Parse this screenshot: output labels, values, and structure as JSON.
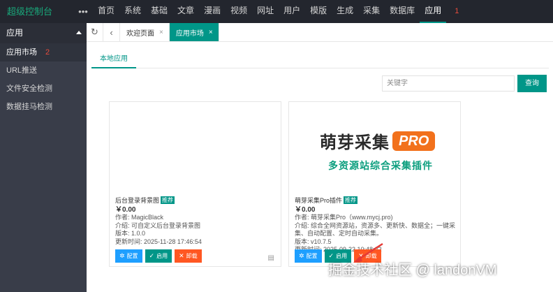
{
  "header": {
    "brand": "超级控制台",
    "dots": "•••",
    "nav": [
      "首页",
      "系统",
      "基础",
      "文章",
      "漫画",
      "视频",
      "网址",
      "用户",
      "模版",
      "生成",
      "采集",
      "数据库",
      "应用"
    ],
    "active_nav": "应用",
    "step_badge": "1"
  },
  "sidebar": {
    "title": "应用",
    "items": [
      "应用市场",
      "URL推送",
      "文件安全检测",
      "数据挂马检测"
    ],
    "active_badge": "2"
  },
  "tabs": {
    "refresh_icon": "↻",
    "back_icon": "‹",
    "pages": [
      {
        "label": "欢迎页面",
        "close": "×"
      },
      {
        "label": "应用市场",
        "close": "×"
      }
    ]
  },
  "main": {
    "subtab": "本地应用",
    "search": {
      "placeholder": "关键字",
      "button": "查询"
    }
  },
  "apps": [
    {
      "title": "后台登录背景图",
      "badge": "推荐",
      "price": "￥0.00",
      "author": "作者: MagicBlack",
      "desc": "介绍: 可自定义后台登录背景图",
      "version": "版本: 1.0.0",
      "updated": "更新时间: 2025-11-28 17:46:54",
      "buttons": {
        "config": "配置",
        "enable": "启用",
        "uninstall": "卸载"
      }
    },
    {
      "logo_main": "萌芽采集",
      "logo_pro": "PRO",
      "logo_sub": "多资源站综合采集插件",
      "title": "萌芽采集Pro插件",
      "badge": "推荐",
      "price": "￥0.00",
      "author": "作者: 萌芽采集Pro（www.mycj.pro)",
      "desc": "介绍: 综合全网资源站，资源多、更新快、数据全；一键采集、自动配置、定时自动采集。",
      "version": "版本: v10.7.5",
      "updated": "更新时间: 2025-09-22 10:48:22",
      "buttons": {
        "config": "配置",
        "enable": "启用",
        "uninstall": "卸载"
      }
    }
  ],
  "watermark": "掘金技术社区 @ landonVM",
  "colors": {
    "accent": "#009688",
    "topbar": "#23262e",
    "sidebar": "#393d49",
    "blue": "#1e9fff",
    "red": "#ff5722",
    "annotation": "#e53935"
  }
}
